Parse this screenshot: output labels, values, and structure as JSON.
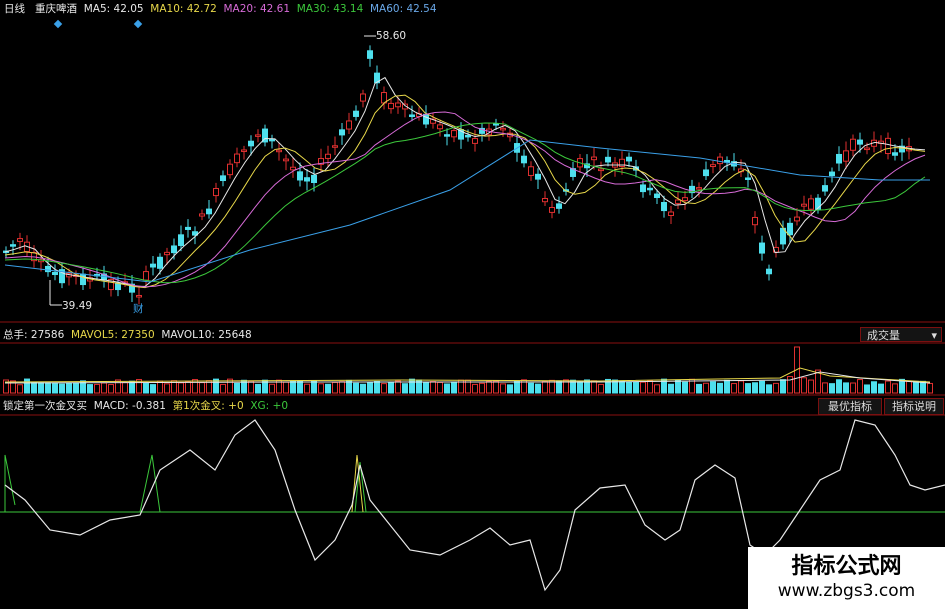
{
  "header": {
    "period": "日线",
    "stock_name": "重庆啤酒",
    "ma": [
      {
        "label": "MA5: ",
        "value": "42.05",
        "color": "#e8e8e8"
      },
      {
        "label": "MA10: ",
        "value": "42.72",
        "color": "#e8d84a"
      },
      {
        "label": "MA20: ",
        "value": "42.61",
        "color": "#d76bd7"
      },
      {
        "label": "MA30: ",
        "value": "43.14",
        "color": "#3cc83c"
      },
      {
        "label": "MA60: ",
        "value": "42.54",
        "color": "#6aa8e8"
      }
    ]
  },
  "price_panel": {
    "high_label": "58.60",
    "low_label": "39.49",
    "marker_label": "财"
  },
  "volume_panel": {
    "total_label": "总手: ",
    "total_value": "27586",
    "mavol5_label": "MAVOL5: ",
    "mavol5_value": "27350",
    "mavol10_label": "MAVOL10: ",
    "mavol10_value": "25648",
    "dropdown_label": "成交量",
    "dropdown_arrow": "▾"
  },
  "indicator_panel": {
    "name": "锁定第一次金叉买",
    "macd_label": "MACD: ",
    "macd_value": "-0.381",
    "first_cross_label": "第1次金叉: ",
    "first_cross_value": "+0",
    "xg_label": "XG: ",
    "xg_value": "+0",
    "best_button": "最优指标",
    "help_button": "指标说明"
  },
  "watermark": {
    "line1": "指标公式网",
    "line2": "www.zbgs3.com"
  },
  "colors": {
    "up": "#e03030",
    "down": "#4ee0ee",
    "panel_border": "#8a1010",
    "zero_line": "#3cc83c"
  }
}
